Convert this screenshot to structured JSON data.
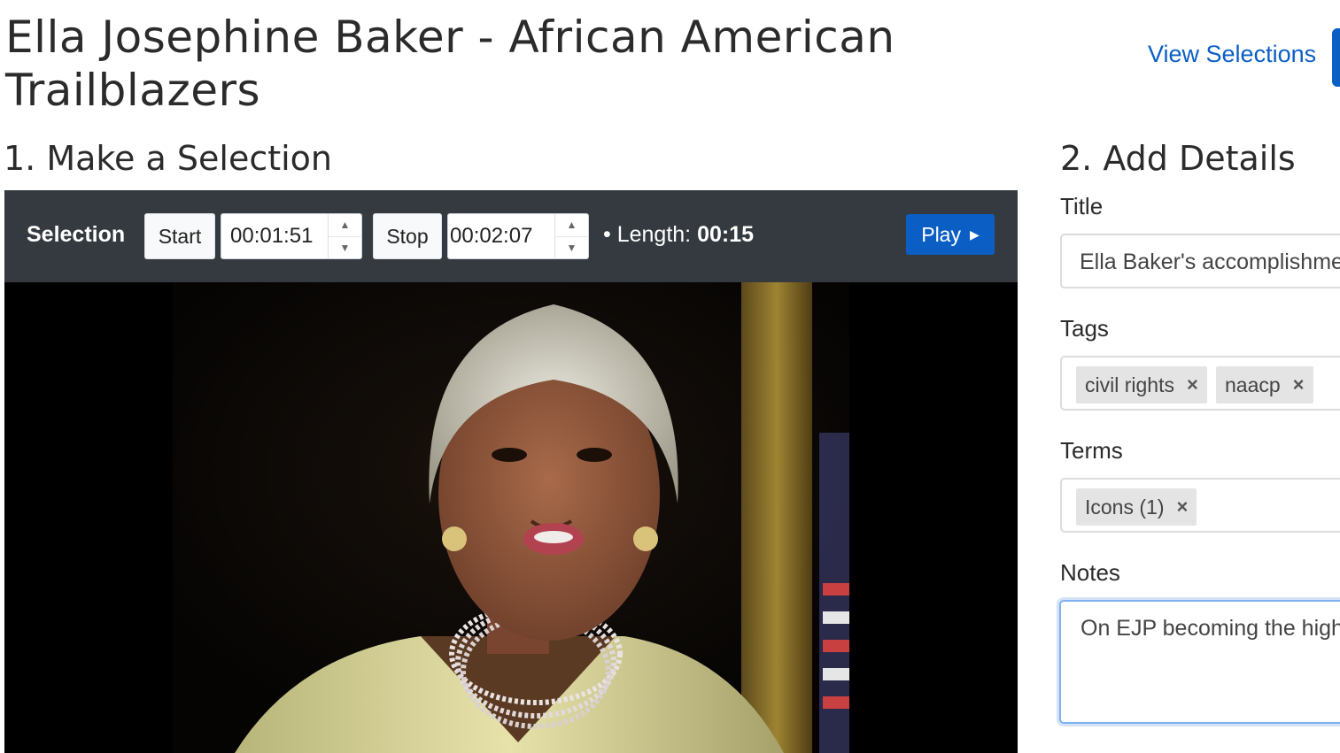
{
  "header": {
    "title": "Ella Josephine Baker - African American Trailblazers",
    "view_selections": "View Selections"
  },
  "selection": {
    "heading": "1. Make a Selection",
    "label": "Selection",
    "start_label": "Start",
    "start_value": "00:01:51",
    "stop_label": "Stop",
    "stop_value": "00:02:07",
    "length_label": "• Length:",
    "length_value": "00:15",
    "play_label": "Play"
  },
  "details": {
    "heading": "2. Add Details",
    "title_label": "Title",
    "title_value": "Ella Baker's accomplishments",
    "tags_label": "Tags",
    "tags": [
      "civil rights",
      "naacp"
    ],
    "terms_label": "Terms",
    "terms": [
      "Icons (1)"
    ],
    "notes_label": "Notes",
    "notes_value": "On EJP becoming the highest"
  },
  "colors": {
    "accent": "#0b5fc4",
    "toolbar": "#343a40"
  }
}
